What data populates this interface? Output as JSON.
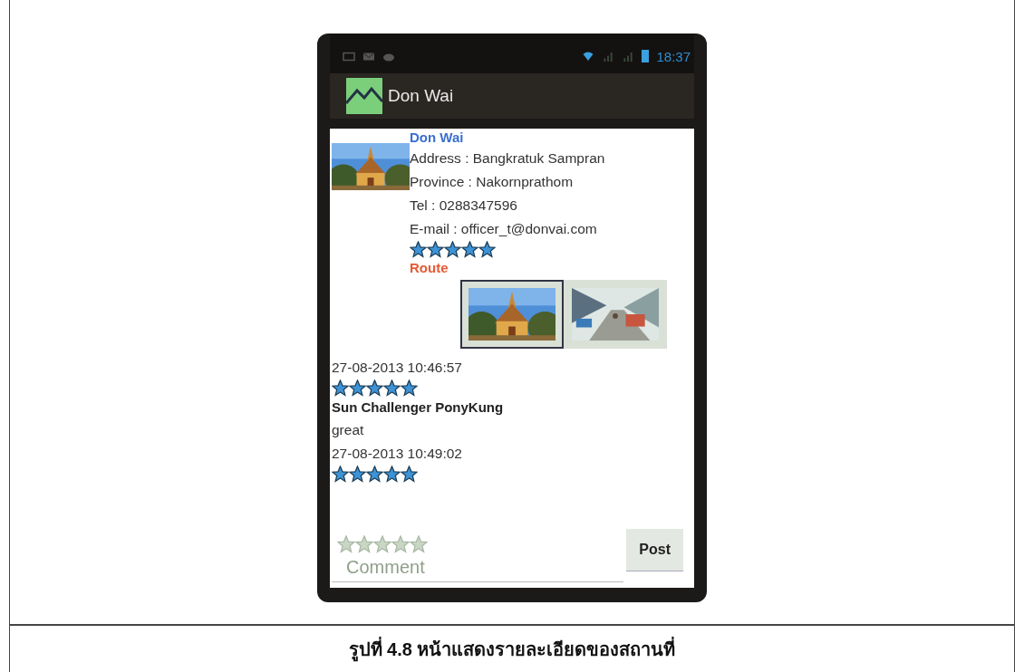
{
  "status_bar": {
    "time": "18:37"
  },
  "action_bar": {
    "title": "Don Wai"
  },
  "place": {
    "name": "Don Wai",
    "details": [
      "Address :  Bangkratuk Sampran",
      "Province : Nakornprathom",
      "Tel : 0288347596",
      "E-mail : officer_t@donvai.com"
    ],
    "stars": 5,
    "route_link": "Route"
  },
  "gallery": [
    {
      "kind": "picture",
      "selected": true
    },
    {
      "kind": "picture",
      "selected": false
    }
  ],
  "comments": [
    {
      "date": "27-08-2013 10:46:57",
      "stars": 5
    },
    {
      "author": "Sun Challenger PonyKung",
      "text": "great",
      "date": "27-08-2013 10:49:02",
      "stars": 5
    }
  ],
  "rating_input": {
    "stars": 0
  },
  "comment_field": {
    "placeholder": "Comment"
  },
  "post_button": "Post",
  "figure_caption": "รูปที่ 4.8 หน้าแสดงรายละเอียดของสถานที่"
}
